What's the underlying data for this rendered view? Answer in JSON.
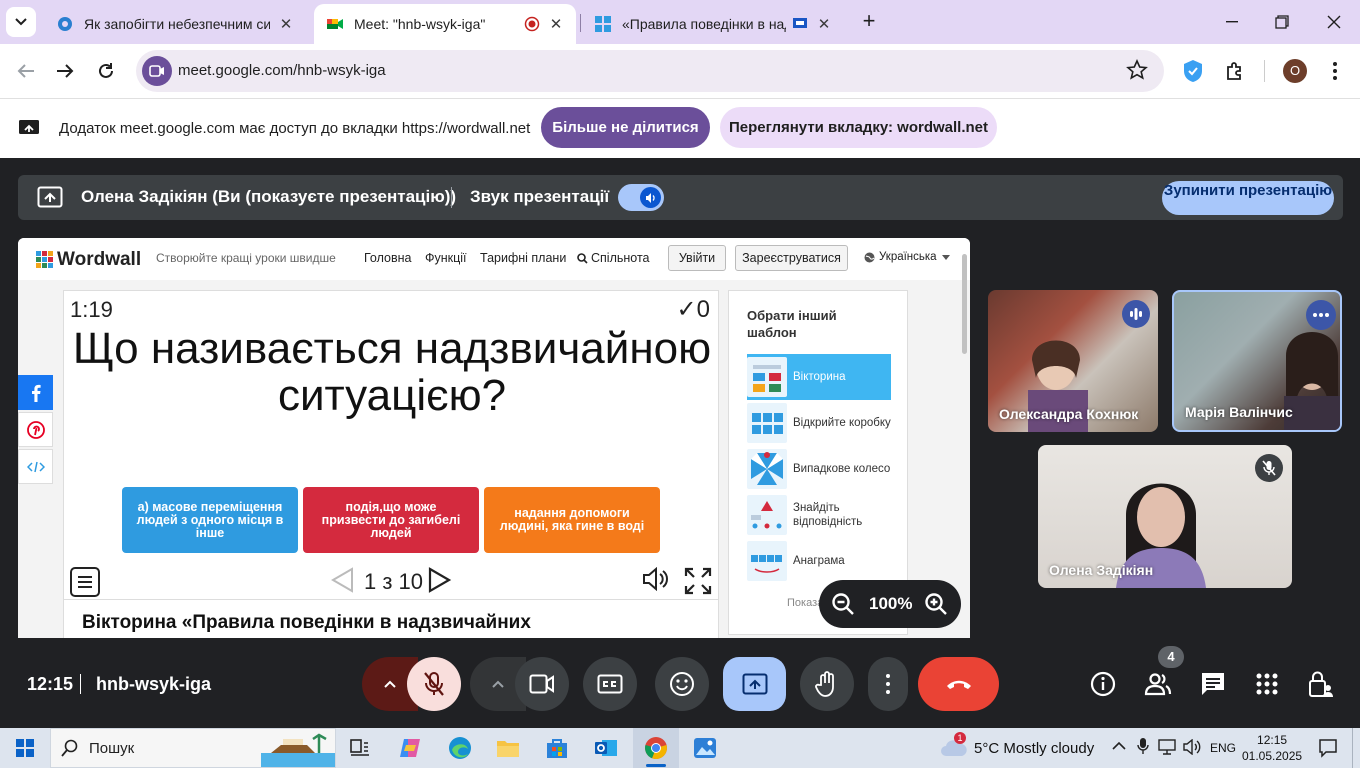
{
  "browser": {
    "tabs": [
      {
        "title": "Як запобігти небезпечним сит",
        "active": false
      },
      {
        "title": "Meet: \"hnb-wsyk-iga\"",
        "active": true
      },
      {
        "title": "«Правила поведінки в над",
        "active": false
      }
    ],
    "url": "meet.google.com/hnb-wsyk-iga",
    "profile_initial": "O"
  },
  "share_bar": {
    "message": "Додаток meet.google.com має доступ до вкладки https://wordwall.net",
    "stop_sharing": "Більше не ділитися",
    "view_tab": "Переглянути вкладку: wordwall.net"
  },
  "meet_top": {
    "presenter": "Олена Задікіян (Ви (показуєте презентацію))",
    "audio_label": "Звук презентації",
    "stop_presenting": "Зупинити презентацію"
  },
  "wordwall": {
    "logo": "Wordwall",
    "tagline": "Створюйте кращі уроки швидше",
    "nav": [
      "Головна",
      "Функції",
      "Тарифні плани",
      "Спільнота"
    ],
    "login": "Увійти",
    "register": "Зареєструватися",
    "language": "Українська",
    "quiz": {
      "timer": "1:19",
      "score": "0",
      "question": "Що називається надзвичайною ситуацією?",
      "answers": [
        {
          "text": "а) масове переміщення людей з одного місця в інше",
          "color": "#2f9be0"
        },
        {
          "text": "подія,що може призвести до загибелі людей",
          "color": "#d42a3e"
        },
        {
          "text": "надання допомоги людині, яка гине в воді",
          "color": "#f47a1a"
        }
      ],
      "page": "1 з 10"
    },
    "quiz_title": "Вікторина «Правила поведінки в надзвичайних",
    "templates": {
      "heading": "Обрати інший шаблон",
      "items": [
        "Вікторина",
        "Відкрийте коробку",
        "Випадкове колесо",
        "Знайдіть відповідність",
        "Анаграма"
      ],
      "more": "Показа"
    },
    "zoom": "100%"
  },
  "participants": [
    {
      "name": "Олександра Кохнюк"
    },
    {
      "name": "Марія Валінчис"
    },
    {
      "name": "Олена Задікіян"
    }
  ],
  "meet_bottom": {
    "time": "12:15",
    "meeting_code": "hnb-wsyk-iga",
    "people_count": "4"
  },
  "taskbar": {
    "search": "Пошук",
    "weather": "5°C  Mostly cloudy",
    "weather_badge": "1",
    "lang": "ENG",
    "time": "12:15",
    "date": "01.05.2025"
  },
  "colors": {
    "accent_purple": "#6b4f9a",
    "meet_red": "#ea4335",
    "meet_blue": "#a8c7fa"
  }
}
